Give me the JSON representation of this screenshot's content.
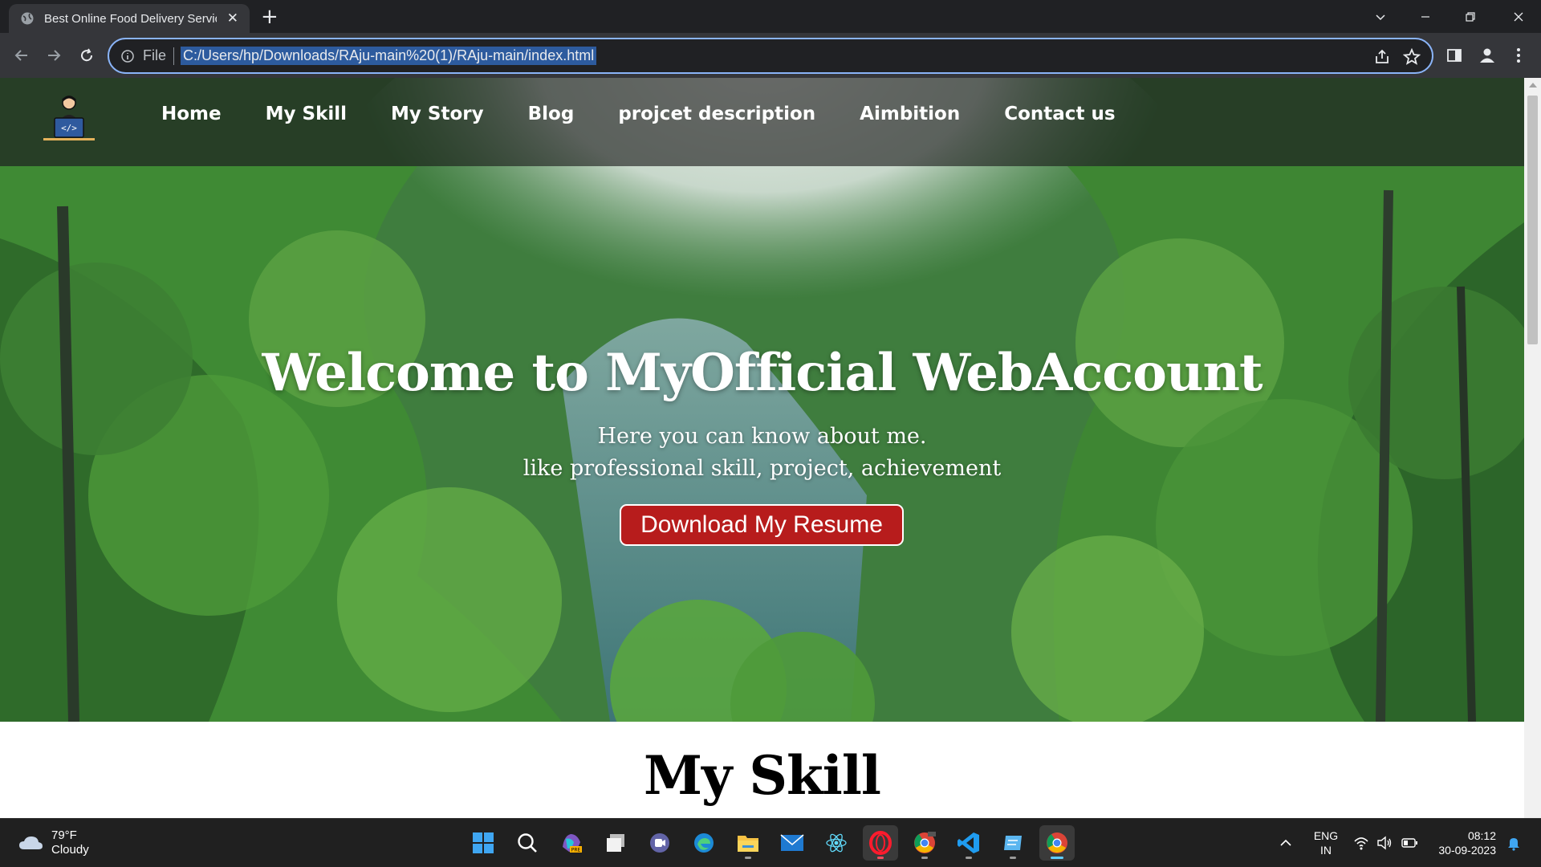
{
  "browser": {
    "tab_title": "Best Online Food Delivery Servic",
    "omnibox_scheme": "File",
    "url": "C:/Users/hp/Downloads/RAju-main%20(1)/RAju-main/index.html"
  },
  "site": {
    "nav": [
      "Home",
      "My Skill",
      "My Story",
      "Blog",
      "projcet description",
      "Aimbition",
      "Contact us"
    ],
    "hero_title": "Welcome to MyOfficial WebAccount",
    "hero_line1": "Here you can know about me.",
    "hero_line2": "like professional skill, project, achievement",
    "resume_button": "Download My Resume",
    "section_title": "My Skill"
  },
  "taskbar": {
    "weather_temp": "79°F",
    "weather_desc": "Cloudy",
    "lang": "ENG",
    "region": "IN",
    "time": "08:12",
    "date": "30-09-2023",
    "apps": [
      "start-icon",
      "search-icon",
      "copilot-pre-icon",
      "task-view-icon",
      "teams-icon",
      "edge-icon",
      "file-explorer-icon",
      "mail-icon",
      "react-icon",
      "opera-icon",
      "chrome-dev-icon",
      "vscode-icon",
      "notepad-icon",
      "chrome-icon"
    ]
  },
  "colors": {
    "accent": "#8ab4f8",
    "resume_button": "#b71c1c"
  }
}
